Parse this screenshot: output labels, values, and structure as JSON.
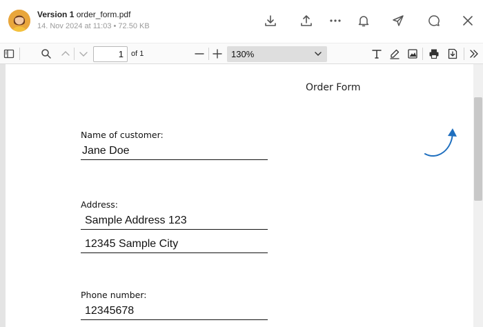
{
  "header": {
    "version_label": "Version 1",
    "file_name": "order_form.pdf",
    "date": "14. Nov 2024 at 11:03",
    "separator": "•",
    "file_size": "72.50 KB",
    "icons": [
      "download-icon",
      "upload-icon",
      "more-icon",
      "bell-icon",
      "send-icon",
      "comment-icon",
      "close-icon"
    ]
  },
  "toolbar": {
    "page_value": "1",
    "page_of": "of 1",
    "zoom": "130%",
    "icons": [
      "sidebar-toggle-icon",
      "search-icon",
      "chevron-up-icon",
      "chevron-down-icon",
      "zoom-out-icon",
      "zoom-in-icon",
      "text-icon",
      "draw-icon",
      "image-icon",
      "print-icon",
      "save-icon",
      "more-tools-icon"
    ]
  },
  "document": {
    "title": "Order Form",
    "fields": [
      {
        "label": "Name of customer:",
        "values": [
          "Jane Doe"
        ]
      },
      {
        "label": "Address:",
        "values": [
          "Sample Address 123",
          "12345 Sample City"
        ]
      },
      {
        "label": "Phone number:",
        "values": [
          "12345678"
        ]
      }
    ]
  },
  "colors": {
    "accent_arrow": "#1f6fbf",
    "toolbar_bg": "#fafafa",
    "viewport_bg": "#e4e4e4"
  }
}
